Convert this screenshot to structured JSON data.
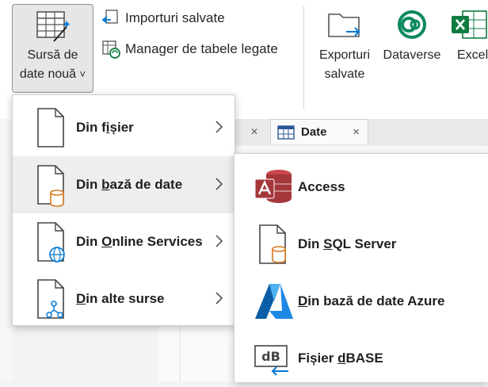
{
  "ribbon": {
    "new_source": {
      "line1": "Sursă de",
      "line2": "date nouă",
      "chevron": "˅"
    },
    "saved_imports": "Importuri salvate",
    "linked_table_manager": "Manager de tabele legate",
    "saved_exports": {
      "line1": "Exporturi",
      "line2": "salvate"
    },
    "dataverse": "Dataverse",
    "excel": "Excel"
  },
  "document": {
    "tab_label": "Date",
    "close_glyph": "×"
  },
  "menu": {
    "items": [
      {
        "pre": "Din f",
        "key": "i",
        "post": "șier"
      },
      {
        "pre": "Din ",
        "key": "b",
        "post": "ază de date"
      },
      {
        "pre": "Din ",
        "key": "O",
        "post": "nline Services"
      },
      {
        "pre": "",
        "key": "D",
        "post": "in alte surse"
      }
    ]
  },
  "submenu": {
    "items": [
      {
        "pre": "",
        "key": "",
        "post": "Access"
      },
      {
        "pre": "Din ",
        "key": "S",
        "post": "QL Server"
      },
      {
        "pre": "",
        "key": "D",
        "post": "in bază de date Azure"
      },
      {
        "pre": "Fișier ",
        "key": "d",
        "post": "BASE"
      }
    ]
  },
  "colors": {
    "accent_orange": "#d77a1e",
    "access_red": "#a4373a",
    "azure_blue": "#0078d4",
    "excel_green": "#107c41",
    "dataverse_teal": "#0b8a5f"
  }
}
